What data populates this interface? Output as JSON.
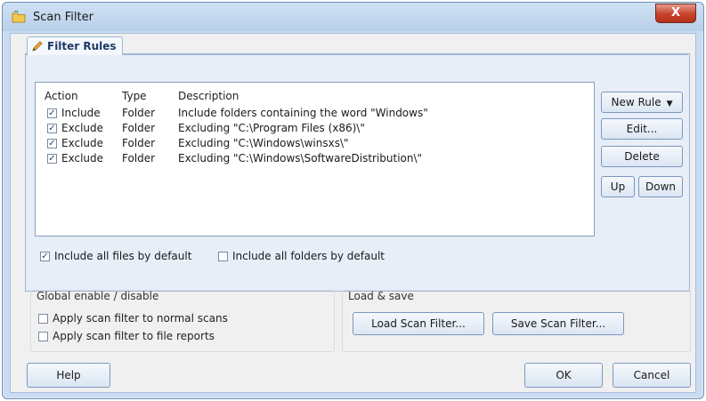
{
  "window": {
    "title": "Scan Filter",
    "close_glyph": "X"
  },
  "filter_tab": {
    "label": "Filter Rules",
    "icon": "pencil-icon"
  },
  "list": {
    "columns": [
      "Action",
      "Type",
      "Description"
    ],
    "rows": [
      {
        "checked": true,
        "action": "Include",
        "type": "Folder",
        "description": "Include folders containing the word \"Windows\""
      },
      {
        "checked": true,
        "action": "Exclude",
        "type": "Folder",
        "description": "Excluding \"C:\\Program Files (x86)\\\""
      },
      {
        "checked": true,
        "action": "Exclude",
        "type": "Folder",
        "description": "Excluding \"C:\\Windows\\winsxs\\\""
      },
      {
        "checked": true,
        "action": "Exclude",
        "type": "Folder",
        "description": "Excluding \"C:\\Windows\\SoftwareDistribution\\\""
      }
    ]
  },
  "rule_buttons": {
    "new_rule": "New Rule",
    "edit": "Edit...",
    "delete": "Delete",
    "up": "Up",
    "down": "Down"
  },
  "defaults": {
    "files": {
      "label": "Include all files by default",
      "checked": true
    },
    "folders": {
      "label": "Include all folders by default",
      "checked": false
    }
  },
  "global": {
    "title": "Global enable / disable",
    "normal_scans": {
      "label": "Apply scan filter to normal scans",
      "checked": false
    },
    "file_reports": {
      "label": "Apply scan filter to file reports",
      "checked": false
    }
  },
  "load_save": {
    "title": "Load & save",
    "load": "Load Scan Filter...",
    "save": "Save Scan Filter..."
  },
  "footer": {
    "help": "Help",
    "ok": "OK",
    "cancel": "Cancel"
  },
  "colors": {
    "title_bg": "#c9dcf1",
    "close_red": "#c7422a",
    "panel_bg": "#e7eef8",
    "check_blue": "#1f3f7a"
  }
}
